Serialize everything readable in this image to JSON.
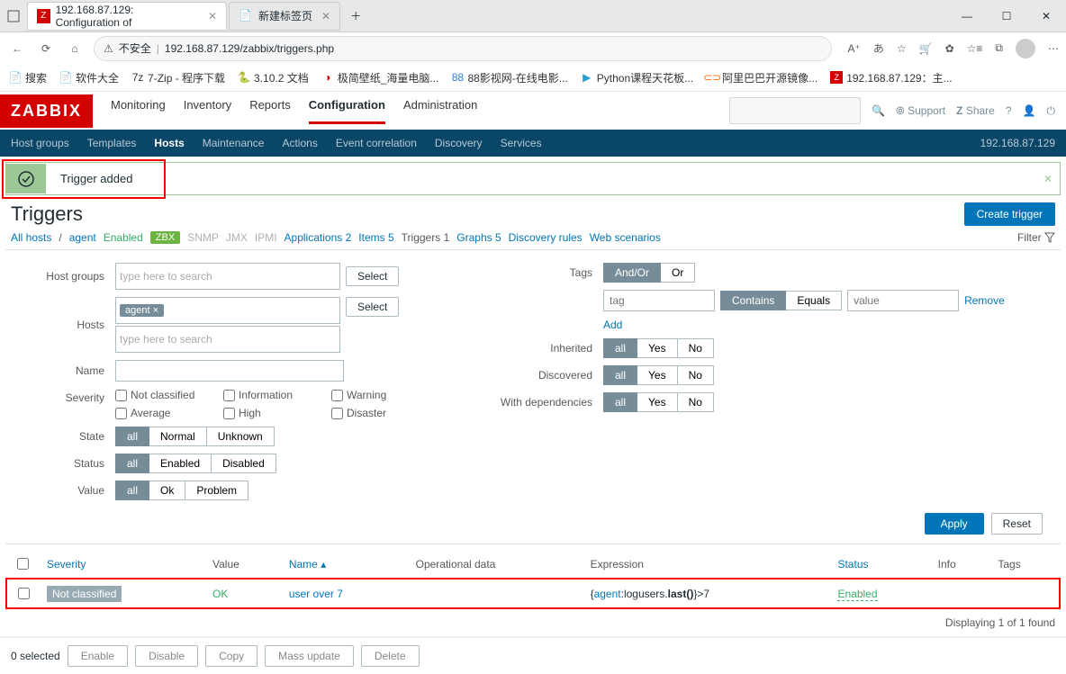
{
  "browser": {
    "tab1_title": "192.168.87.129: Configuration of",
    "tab2_title": "新建标签页",
    "insecure": "不安全",
    "url": "192.168.87.129/zabbix/triggers.php"
  },
  "bookmarks": {
    "b1": "搜索",
    "b2": "软件大全",
    "b3": "7-Zip - 程序下载",
    "b4": "3.10.2 文档",
    "b5": "极简壁纸_海量电脑...",
    "b6": "88影视网-在线电影...",
    "b7": "Python课程天花板...",
    "b8": "阿里巴巴开源镜像...",
    "b9": "192.168.87.129：主..."
  },
  "zbx": {
    "logo": "ZABBIX",
    "menu": {
      "m1": "Monitoring",
      "m2": "Inventory",
      "m3": "Reports",
      "m4": "Configuration",
      "m5": "Administration"
    },
    "right": {
      "support": "Support",
      "share": "Share"
    },
    "sub": {
      "s1": "Host groups",
      "s2": "Templates",
      "s3": "Hosts",
      "s4": "Maintenance",
      "s5": "Actions",
      "s6": "Event correlation",
      "s7": "Discovery",
      "s8": "Services"
    },
    "ip": "192.168.87.129"
  },
  "alert": {
    "msg": "Trigger added"
  },
  "page": {
    "title": "Triggers",
    "create_btn": "Create trigger"
  },
  "crumbs": {
    "allhosts": "All hosts",
    "agent": "agent",
    "enabled": "Enabled",
    "zbx": "ZBX",
    "snmp": "SNMP",
    "jmx": "JMX",
    "ipmi": "IPMI",
    "apps": "Applications",
    "apps_n": "2",
    "items": "Items",
    "items_n": "5",
    "triggers": "Triggers",
    "triggers_n": "1",
    "graphs": "Graphs",
    "graphs_n": "5",
    "disc": "Discovery rules",
    "web": "Web scenarios",
    "filter": "Filter"
  },
  "filter": {
    "host_groups": "Host groups",
    "hosts": "Hosts",
    "name": "Name",
    "severity": "Severity",
    "state": "State",
    "status": "Status",
    "value": "Value",
    "select": "Select",
    "type_search": "type here to search",
    "agent_tag": "agent ×",
    "sev": {
      "nc": "Not classified",
      "info": "Information",
      "warn": "Warning",
      "avg": "Average",
      "high": "High",
      "dis": "Disaster"
    },
    "all": "all",
    "normal": "Normal",
    "unknown": "Unknown",
    "enabled": "Enabled",
    "disabled": "Disabled",
    "ok": "Ok",
    "problem": "Problem",
    "tags": "Tags",
    "andor": "And/Or",
    "or": "Or",
    "tag_ph": "tag",
    "contains": "Contains",
    "equals": "Equals",
    "value_ph": "value",
    "remove": "Remove",
    "add": "Add",
    "inherited": "Inherited",
    "discovered": "Discovered",
    "withdep": "With dependencies",
    "yes": "Yes",
    "no": "No",
    "apply": "Apply",
    "reset": "Reset"
  },
  "table": {
    "h_sev": "Severity",
    "h_val": "Value",
    "h_name": "Name",
    "h_op": "Operational data",
    "h_expr": "Expression",
    "h_status": "Status",
    "h_info": "Info",
    "h_tags": "Tags",
    "r_sev": "Not classified",
    "r_val": "OK",
    "r_name": "user over 7",
    "r_expr_pre": "{",
    "r_expr_host": "agent",
    "r_expr_mid": ":logusers.",
    "r_expr_last": "last()",
    "r_expr_post": "}>7",
    "r_status": "Enabled",
    "footer": "Displaying 1 of 1 found"
  },
  "bulk": {
    "selected": "0 selected",
    "enable": "Enable",
    "disable": "Disable",
    "copy": "Copy",
    "mass": "Mass update",
    "delete": "Delete"
  }
}
